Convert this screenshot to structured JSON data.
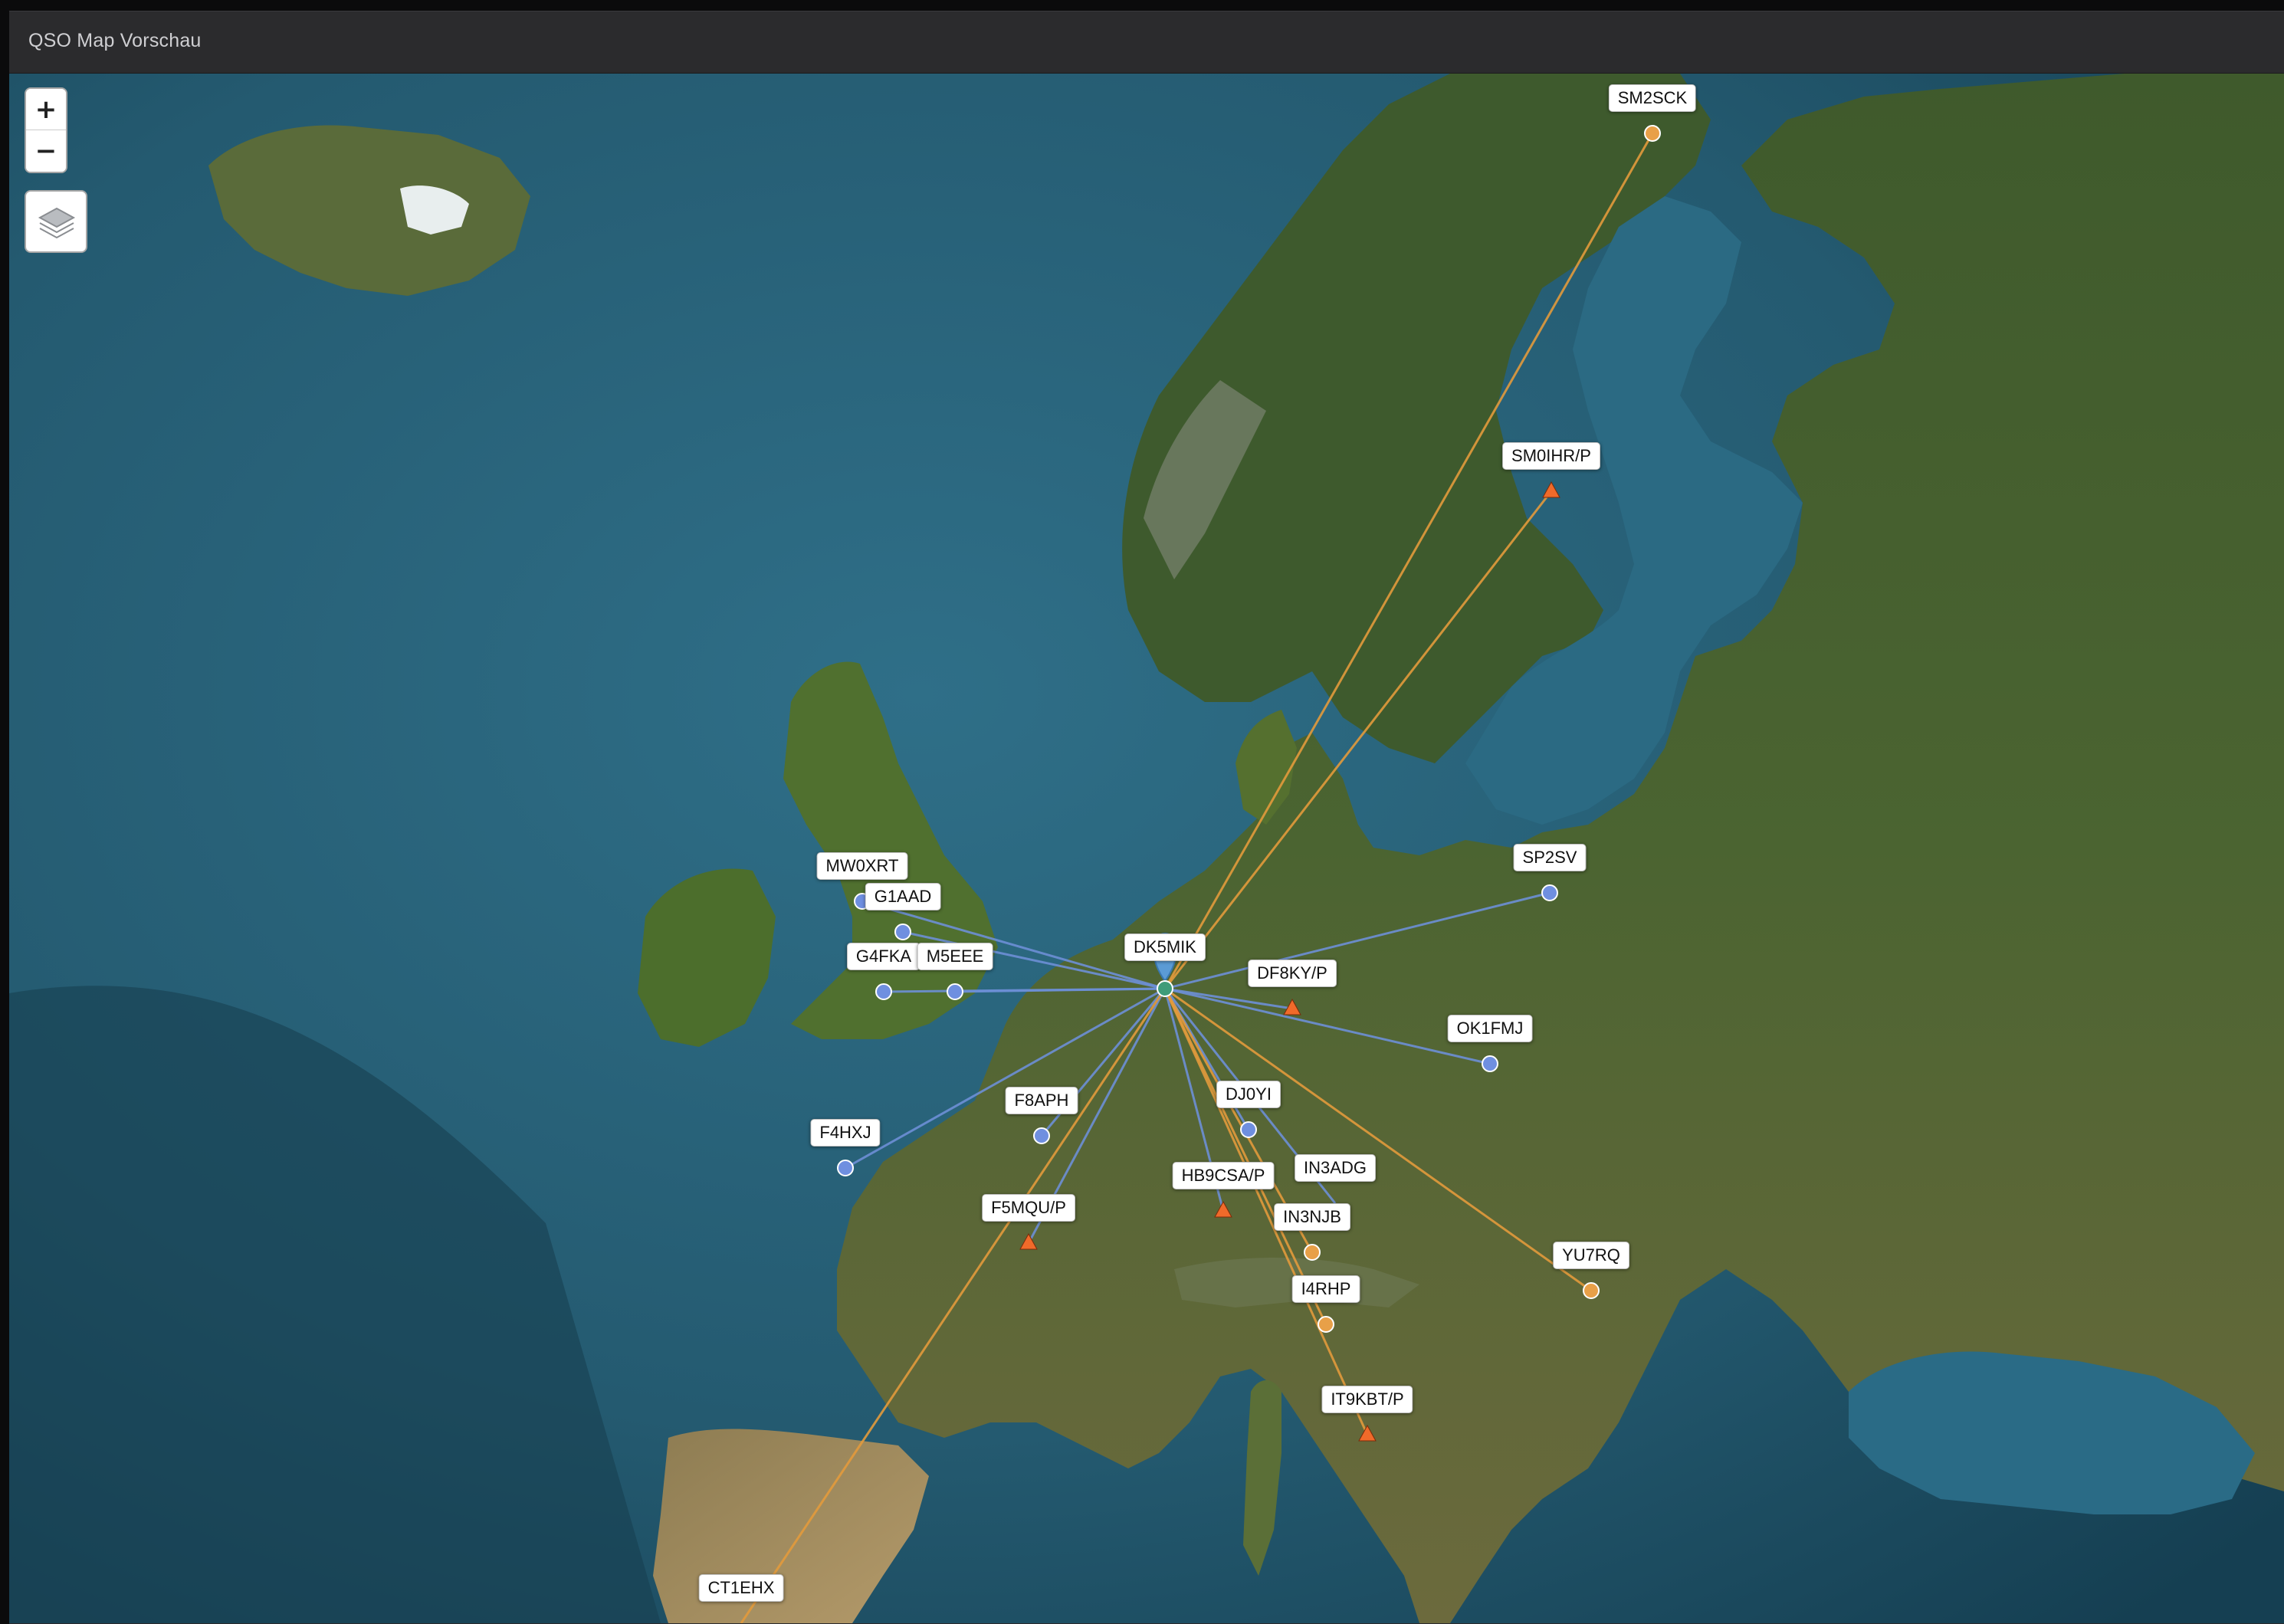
{
  "window": {
    "title": "QSO Map Vorschau"
  },
  "controls": {
    "zoom_in": "+",
    "zoom_out": "−",
    "layers_icon": "layers-icon"
  },
  "colors": {
    "line_blue": "#6d8fd6",
    "line_orange": "#e29a3c",
    "marker_blue": "#6f8fe0",
    "marker_orange": "#e8a048",
    "marker_triangle": "#f06a2a",
    "home_marker": "#5b9bd5"
  },
  "home": {
    "call": "DK5MIK"
  },
  "qsos": [
    {
      "call": "SM2SCK",
      "marker": "circle-orange",
      "line": "orange"
    },
    {
      "call": "SM0IHR/P",
      "marker": "triangle",
      "line": "orange"
    },
    {
      "call": "SP2SV",
      "marker": "circle-blue",
      "line": "blue"
    },
    {
      "call": "MW0XRT",
      "marker": "circle-blue",
      "line": "blue"
    },
    {
      "call": "G1AAD",
      "marker": "circle-blue",
      "line": "blue"
    },
    {
      "call": "G4FKA",
      "marker": "circle-blue",
      "line": "blue"
    },
    {
      "call": "M5EEE",
      "marker": "circle-blue",
      "line": "blue"
    },
    {
      "call": "DF8KY/P",
      "marker": "triangle",
      "line": "blue"
    },
    {
      "call": "OK1FMJ",
      "marker": "circle-blue",
      "line": "blue"
    },
    {
      "call": "DJ0YI",
      "marker": "circle-blue",
      "line": "blue"
    },
    {
      "call": "F8APH",
      "marker": "circle-blue",
      "line": "blue"
    },
    {
      "call": "F4HXJ",
      "marker": "circle-blue",
      "line": "blue"
    },
    {
      "call": "HB9CSA/P",
      "marker": "triangle",
      "line": "blue"
    },
    {
      "call": "IN3ADG",
      "marker": "none",
      "line": "blue"
    },
    {
      "call": "IN3NJB",
      "marker": "circle-orange",
      "line": "orange"
    },
    {
      "call": "F5MQU/P",
      "marker": "triangle",
      "line": "blue"
    },
    {
      "call": "YU7RQ",
      "marker": "circle-orange",
      "line": "orange"
    },
    {
      "call": "I4RHP",
      "marker": "circle-orange",
      "line": "orange"
    },
    {
      "call": "IT9KBT/P",
      "marker": "triangle",
      "line": "orange"
    },
    {
      "call": "CT1EHX",
      "marker": "none",
      "line": "orange"
    }
  ]
}
